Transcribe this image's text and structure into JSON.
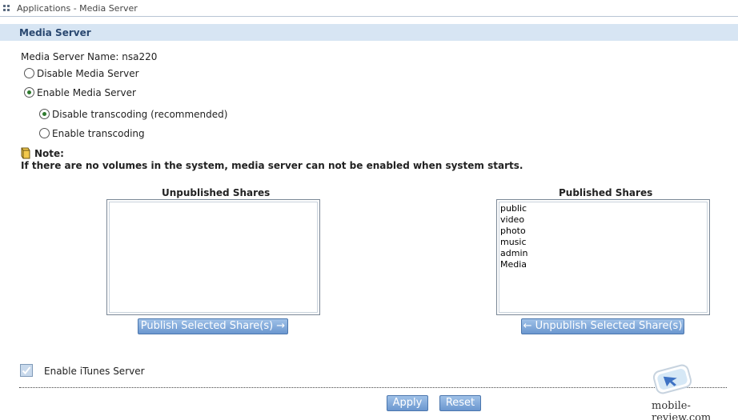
{
  "window": {
    "title": "Applications - Media Server"
  },
  "section": {
    "title": "Media Server"
  },
  "media_server_name": "Media Server Name: nsa220",
  "server_options": [
    {
      "label": "Disable Media Server",
      "selected": false
    },
    {
      "label": "Enable Media Server",
      "selected": true
    }
  ],
  "transcoding_options": [
    {
      "label": "Disable transcoding (recommended)",
      "selected": true
    },
    {
      "label": "Enable transcoding",
      "selected": false
    }
  ],
  "note": {
    "title": "Note:",
    "text": "If there are no volumes in the system, media server can not be enabled when system starts."
  },
  "unpublished": {
    "header": "Unpublished Shares",
    "items": []
  },
  "published": {
    "header": "Published Shares",
    "items": [
      "public",
      "video",
      "photo",
      "music",
      "admin",
      "Media"
    ]
  },
  "buttons": {
    "publish": "Publish Selected Share(s) →",
    "unpublish": "← Unpublish Selected Share(s)",
    "apply": "Apply",
    "reset": "Reset"
  },
  "itunes": {
    "label": "Enable iTunes Server",
    "checked": true
  },
  "watermark": {
    "text": "mobile-review.com"
  },
  "colors": {
    "header_bg": "#d7e5f3",
    "button_bg": "#7aa3d6",
    "radio_dot": "#2d7a2d"
  }
}
